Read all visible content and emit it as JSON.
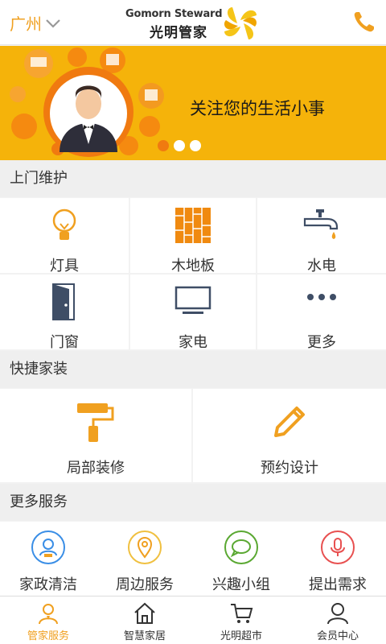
{
  "header": {
    "city": "广州",
    "logo_en": "Gomorn Steward",
    "logo_cn": "光明管家",
    "phone_icon": "phone-icon"
  },
  "banner": {
    "slogan": "关注您的生活小事",
    "dots": 3,
    "active_dot": 0
  },
  "sections": {
    "maintenance": {
      "title": "上门维护",
      "items": [
        {
          "label": "灯具",
          "icon": "bulb-icon"
        },
        {
          "label": "木地板",
          "icon": "wood-floor-icon"
        },
        {
          "label": "水电",
          "icon": "faucet-icon"
        },
        {
          "label": "门窗",
          "icon": "door-icon"
        },
        {
          "label": "家电",
          "icon": "monitor-icon"
        },
        {
          "label": "更多",
          "icon": "more-icon"
        }
      ]
    },
    "decoration": {
      "title": "快捷家装",
      "items": [
        {
          "label": "局部装修",
          "icon": "paint-roller-icon"
        },
        {
          "label": "预约设计",
          "icon": "pencil-icon"
        }
      ]
    },
    "more": {
      "title": "更多服务",
      "items": [
        {
          "label": "家政清洁",
          "icon": "cleaner-icon"
        },
        {
          "label": "周边服务",
          "icon": "location-pin-icon"
        },
        {
          "label": "兴趣小组",
          "icon": "chat-bubble-icon"
        },
        {
          "label": "提出需求",
          "icon": "microphone-icon"
        }
      ]
    }
  },
  "tabs": [
    {
      "label": "管家服务",
      "icon": "steward-icon",
      "active": true
    },
    {
      "label": "智慧家居",
      "icon": "home-icon",
      "active": false
    },
    {
      "label": "光明超市",
      "icon": "cart-icon",
      "active": false
    },
    {
      "label": "会员中心",
      "icon": "user-icon",
      "active": false
    }
  ],
  "colors": {
    "accent": "#f0a020",
    "banner_bg": "#f5b30a",
    "icon_dark": "#3f4e66"
  }
}
